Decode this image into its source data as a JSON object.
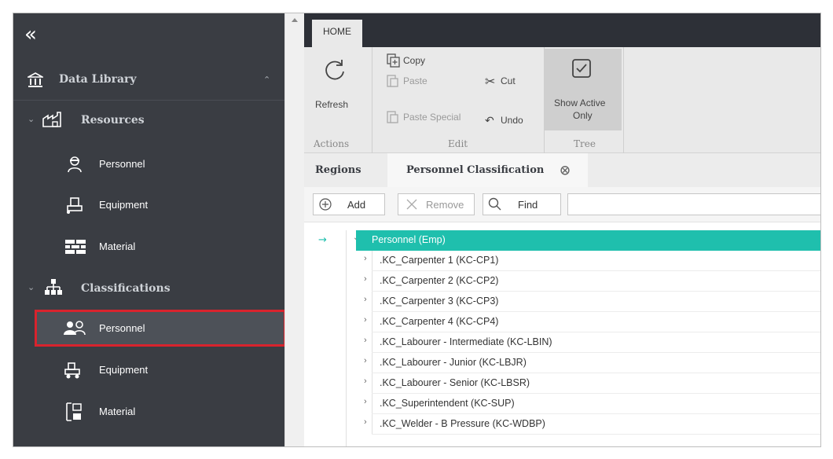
{
  "sidebar": {
    "collapse_glyph": "«",
    "data_library": "Data Library",
    "resources": "Resources",
    "resources_items": [
      "Personnel",
      "Equipment",
      "Material"
    ],
    "classifications": "Classifications",
    "classifications_items": [
      "Personnel",
      "Equipment",
      "Material"
    ],
    "selected_item": "Personnel"
  },
  "ribbon": {
    "home_tab": "HOME",
    "refresh": "Refresh",
    "copy": "Copy",
    "paste": "Paste",
    "paste_special": "Paste Special",
    "cut": "Cut",
    "undo": "Undo",
    "show_active_only_1": "Show Active",
    "show_active_only_2": "Only",
    "groups": [
      "Actions",
      "Edit",
      "Tree"
    ]
  },
  "tabs": {
    "regions": "Regions",
    "personnel_classification": "Personnel Classification"
  },
  "toolbar": {
    "add": "Add",
    "remove": "Remove",
    "find": "Find",
    "search_value": ""
  },
  "tree": {
    "root": "Personnel (Emp)",
    "rows": [
      ".KC_Carpenter 1 (KC-CP1)",
      ".KC_Carpenter 2 (KC-CP2)",
      ".KC_Carpenter 3 (KC-CP3)",
      ".KC_Carpenter 4 (KC-CP4)",
      ".KC_Labourer - Intermediate (KC-LBIN)",
      ".KC_Labourer - Junior (KC-LBJR)",
      ".KC_Labourer - Senior (KC-LBSR)",
      ".KC_Superintendent (KC-SUP)",
      ".KC_Welder - B Pressure (KC-WDBP)"
    ]
  },
  "colors": {
    "sidebar_bg": "#3a3d43",
    "selected_border": "#d9232d",
    "tree_root_bg": "#1fbfad"
  }
}
